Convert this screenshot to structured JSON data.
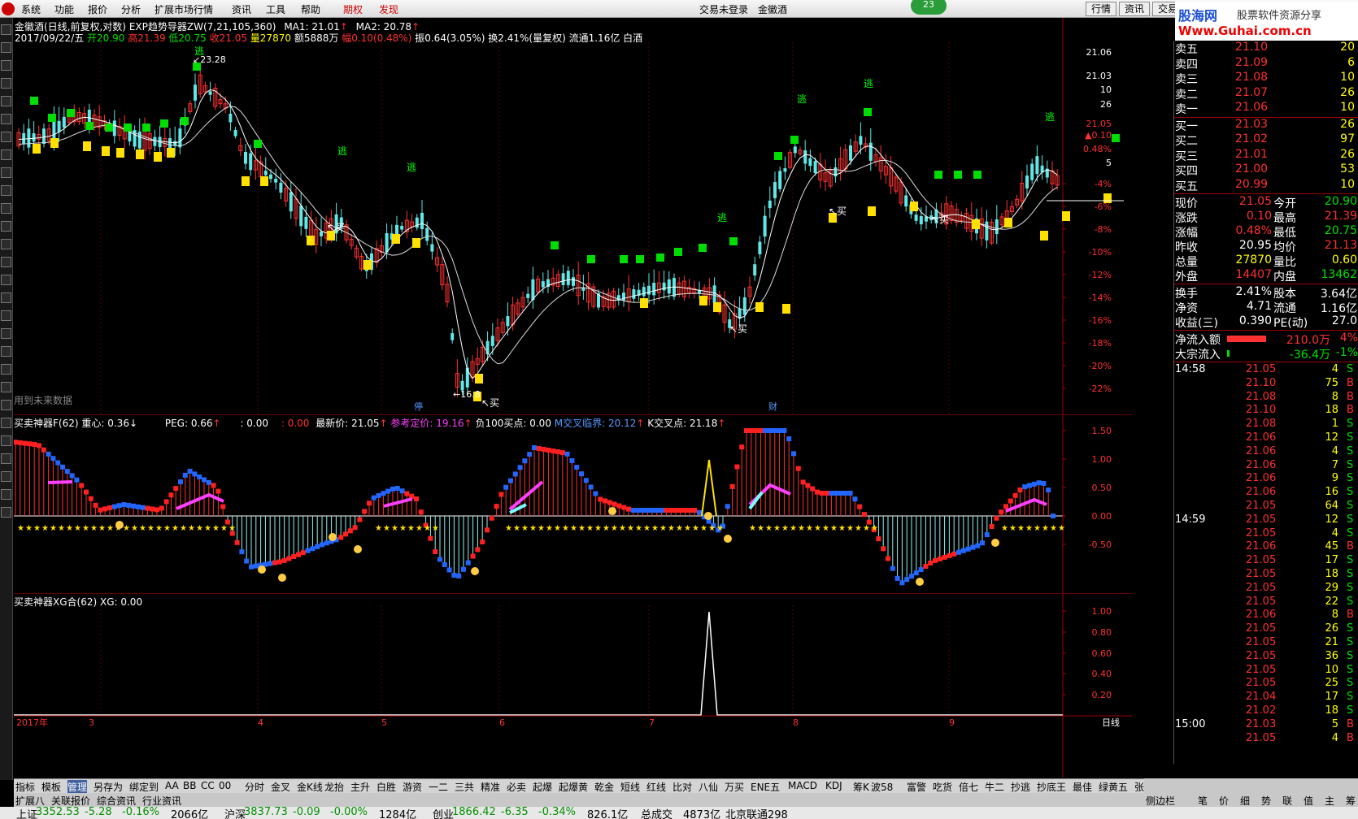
{
  "menu": {
    "items": [
      "系统",
      "功能",
      "报价",
      "分析",
      "扩展市场行情",
      "资讯",
      "工具",
      "帮助",
      "期权",
      "发现"
    ],
    "status_login": "交易未登录",
    "stock_name": "金徽酒",
    "badge": "23",
    "right_buttons": [
      "行情",
      "资讯",
      "交易"
    ]
  },
  "brand": {
    "line1": "股海网",
    "line2": "股票软件资源分享",
    "line3": "Www.Guhai.com.cn"
  },
  "main": {
    "title": "金徽酒(日线,前复权,对数)",
    "indicator": "EXP趋势导器ZW(7,21,105,360)",
    "ma1": "MA1: 21.01",
    "ma2": "MA2: 20.78",
    "date": "2017/09/22/五",
    "open": "开20.90",
    "high": "高21.39",
    "low": "低20.75",
    "close": "收21.05",
    "volume": "量27870",
    "amount": "额5888万",
    "change": "幅0.10(0.48%)",
    "amplitude": "振0.64(3.05%)",
    "turnover": "换2.41%(量复权)",
    "float": "流通1.16亿",
    "liquor": "白酒",
    "future_note": "用到未来数据",
    "high_label": "23.28",
    "low_label": "16.8",
    "labels": {
      "escape": "逃",
      "buy": "买",
      "other1": "停",
      "other2": "财"
    },
    "y_ticks_price": [
      "21.06",
      "21.03",
      "10",
      "26",
      "21.05",
      "▲0.10",
      "0.48%",
      "5"
    ],
    "y_ticks_pct": [
      "-4%",
      "-6%",
      "-8%",
      "-10%",
      "-12%",
      "-14%",
      "-16%",
      "-18%",
      "-20%",
      "-22%"
    ]
  },
  "ind1": {
    "name": "买卖神器F(62)",
    "center": "重心: 0.36",
    "peg": "PEG: 0.66",
    "v1": ": 0.00",
    "v2": ": 0.00",
    "last_price": "最新价: 21.05",
    "ref_price": "参考定价: 19.16",
    "buy100": "负100买点: 0.00",
    "m_cross": "M交叉临界: 20.12",
    "k_cross": "K交叉点: 21.18",
    "ticks": [
      "1.50",
      "1.00",
      "0.50",
      "0.00",
      "-0.50"
    ]
  },
  "ind2": {
    "name": "买卖神器XG合(62)",
    "xg": "XG: 0.00",
    "ticks": [
      "1.00",
      "0.80",
      "0.60",
      "0.40",
      "0.20"
    ]
  },
  "xaxis": {
    "year": "2017年",
    "months": [
      "3",
      "4",
      "5",
      "6",
      "7",
      "8",
      "9"
    ],
    "right": "日线"
  },
  "bottom_tabs": [
    "指标",
    "模板",
    "管理",
    "另存为",
    "绑定到",
    "AA",
    "BB",
    "CC",
    "00",
    "分时",
    "金叉",
    "金K线",
    "龙抬",
    "主升",
    "白胜",
    "游资",
    "一二",
    "三共",
    "精准",
    "必卖",
    "起爆",
    "起爆黄",
    "乾金",
    "短线",
    "红线",
    "比对",
    "八仙",
    "万买",
    "ENE五",
    "MACD",
    "KDJ",
    "筹K",
    "波58",
    "富警",
    "吃货",
    "倍七",
    "牛二",
    "抄逃",
    "抄底王",
    "最佳",
    "绿黄五",
    "张五"
  ],
  "sub_tabs": [
    "扩展八",
    "关联报价",
    "综合资讯",
    "行业资讯"
  ],
  "panel": {
    "asks": [
      {
        "label": "卖五",
        "price": "21.10",
        "vol": "20"
      },
      {
        "label": "卖四",
        "price": "21.09",
        "vol": "6"
      },
      {
        "label": "卖三",
        "price": "21.08",
        "vol": "10"
      },
      {
        "label": "卖二",
        "price": "21.07",
        "vol": "26"
      },
      {
        "label": "卖一",
        "price": "21.06",
        "vol": "10"
      }
    ],
    "bids": [
      {
        "label": "买一",
        "price": "21.03",
        "vol": "26"
      },
      {
        "label": "买二",
        "price": "21.02",
        "vol": "97"
      },
      {
        "label": "买三",
        "price": "21.01",
        "vol": "26"
      },
      {
        "label": "买四",
        "price": "21.00",
        "vol": "53"
      },
      {
        "label": "买五",
        "price": "20.99",
        "vol": "10"
      }
    ],
    "stats": [
      {
        "l1": "现价",
        "v1": "21.05",
        "l2": "今开",
        "v2": "20.90",
        "c1": "red",
        "c2": "green"
      },
      {
        "l1": "涨跌",
        "v1": "0.10",
        "l2": "最高",
        "v2": "21.39",
        "c1": "red",
        "c2": "red"
      },
      {
        "l1": "涨幅",
        "v1": "0.48%",
        "l2": "最低",
        "v2": "20.75",
        "c1": "red",
        "c2": "green"
      },
      {
        "l1": "昨收",
        "v1": "20.95",
        "l2": "均价",
        "v2": "21.13",
        "c1": "white",
        "c2": "red"
      },
      {
        "l1": "总量",
        "v1": "27870",
        "l2": "量比",
        "v2": "0.60",
        "c1": "yellow",
        "c2": "yellow"
      },
      {
        "l1": "外盘",
        "v1": "14407",
        "l2": "内盘",
        "v2": "13462",
        "c1": "red",
        "c2": "green"
      }
    ],
    "stats2": [
      {
        "l1": "换手",
        "v1": "2.41%",
        "l2": "股本",
        "v2": "3.64亿"
      },
      {
        "l1": "净资",
        "v1": "4.71",
        "l2": "流通",
        "v2": "1.16亿"
      },
      {
        "l1": "收益(三)",
        "v1": "0.390",
        "l2": "PE(动)",
        "v2": "27.0"
      }
    ],
    "flow": [
      {
        "label": "净流入额",
        "value": "210.0万",
        "pct": "4%",
        "ratio": 0.8,
        "color": "red"
      },
      {
        "label": "大宗流入",
        "value": "-36.4万",
        "pct": "-1%",
        "ratio": 0.05,
        "color": "green"
      }
    ],
    "ticks": [
      {
        "t": "14:58",
        "p": "21.05",
        "v": "4",
        "s": "S"
      },
      {
        "t": "",
        "p": "21.10",
        "v": "75",
        "s": "B"
      },
      {
        "t": "",
        "p": "21.08",
        "v": "8",
        "s": "B"
      },
      {
        "t": "",
        "p": "21.10",
        "v": "18",
        "s": "B"
      },
      {
        "t": "",
        "p": "21.08",
        "v": "1",
        "s": "S"
      },
      {
        "t": "",
        "p": "21.06",
        "v": "12",
        "s": "S"
      },
      {
        "t": "",
        "p": "21.06",
        "v": "4",
        "s": "S"
      },
      {
        "t": "",
        "p": "21.06",
        "v": "7",
        "s": "S"
      },
      {
        "t": "",
        "p": "21.06",
        "v": "9",
        "s": "S"
      },
      {
        "t": "",
        "p": "21.06",
        "v": "16",
        "s": "S"
      },
      {
        "t": "",
        "p": "21.05",
        "v": "64",
        "s": "S"
      },
      {
        "t": "14:59",
        "p": "21.05",
        "v": "12",
        "s": "S"
      },
      {
        "t": "",
        "p": "21.05",
        "v": "4",
        "s": "S"
      },
      {
        "t": "",
        "p": "21.06",
        "v": "45",
        "s": "B"
      },
      {
        "t": "",
        "p": "21.05",
        "v": "17",
        "s": "S"
      },
      {
        "t": "",
        "p": "21.05",
        "v": "18",
        "s": "S"
      },
      {
        "t": "",
        "p": "21.05",
        "v": "29",
        "s": "S"
      },
      {
        "t": "",
        "p": "21.05",
        "v": "22",
        "s": "S"
      },
      {
        "t": "",
        "p": "21.06",
        "v": "8",
        "s": "B"
      },
      {
        "t": "",
        "p": "21.05",
        "v": "26",
        "s": "S"
      },
      {
        "t": "",
        "p": "21.05",
        "v": "21",
        "s": "S"
      },
      {
        "t": "",
        "p": "21.05",
        "v": "36",
        "s": "S"
      },
      {
        "t": "",
        "p": "21.05",
        "v": "10",
        "s": "S"
      },
      {
        "t": "",
        "p": "21.05",
        "v": "25",
        "s": "S"
      },
      {
        "t": "",
        "p": "21.04",
        "v": "17",
        "s": "S"
      },
      {
        "t": "",
        "p": "21.02",
        "v": "18",
        "s": "S"
      },
      {
        "t": "15:00",
        "p": "21.03",
        "v": "5",
        "s": "B"
      },
      {
        "t": "",
        "p": "21.05",
        "v": "4",
        "s": "B"
      }
    ],
    "tabs": [
      "侧边栏",
      "笔",
      "价",
      "细",
      "势",
      "联",
      "值",
      "主",
      "筹"
    ]
  },
  "status": {
    "items": [
      {
        "name": "上证",
        "v": "3352.53",
        "c": "-5.28",
        "p": "-0.16%",
        "a": "2066亿"
      },
      {
        "name": "沪深",
        "v": "3837.73",
        "c": "-0.09",
        "p": "-0.00%",
        "a": "1284亿"
      },
      {
        "name": "创业",
        "v": "1866.42",
        "c": "-6.35",
        "p": "-0.34%",
        "a": "826.1亿"
      }
    ],
    "total": "总成交",
    "total_v": "4873亿",
    "server": "北京联通298"
  },
  "chart_data": {
    "type": "candlestick",
    "note_months": [
      "3",
      "4",
      "5",
      "6",
      "7",
      "8",
      "9"
    ],
    "price_high": 23.28,
    "price_low": 16.8,
    "last_close": 21.05
  }
}
